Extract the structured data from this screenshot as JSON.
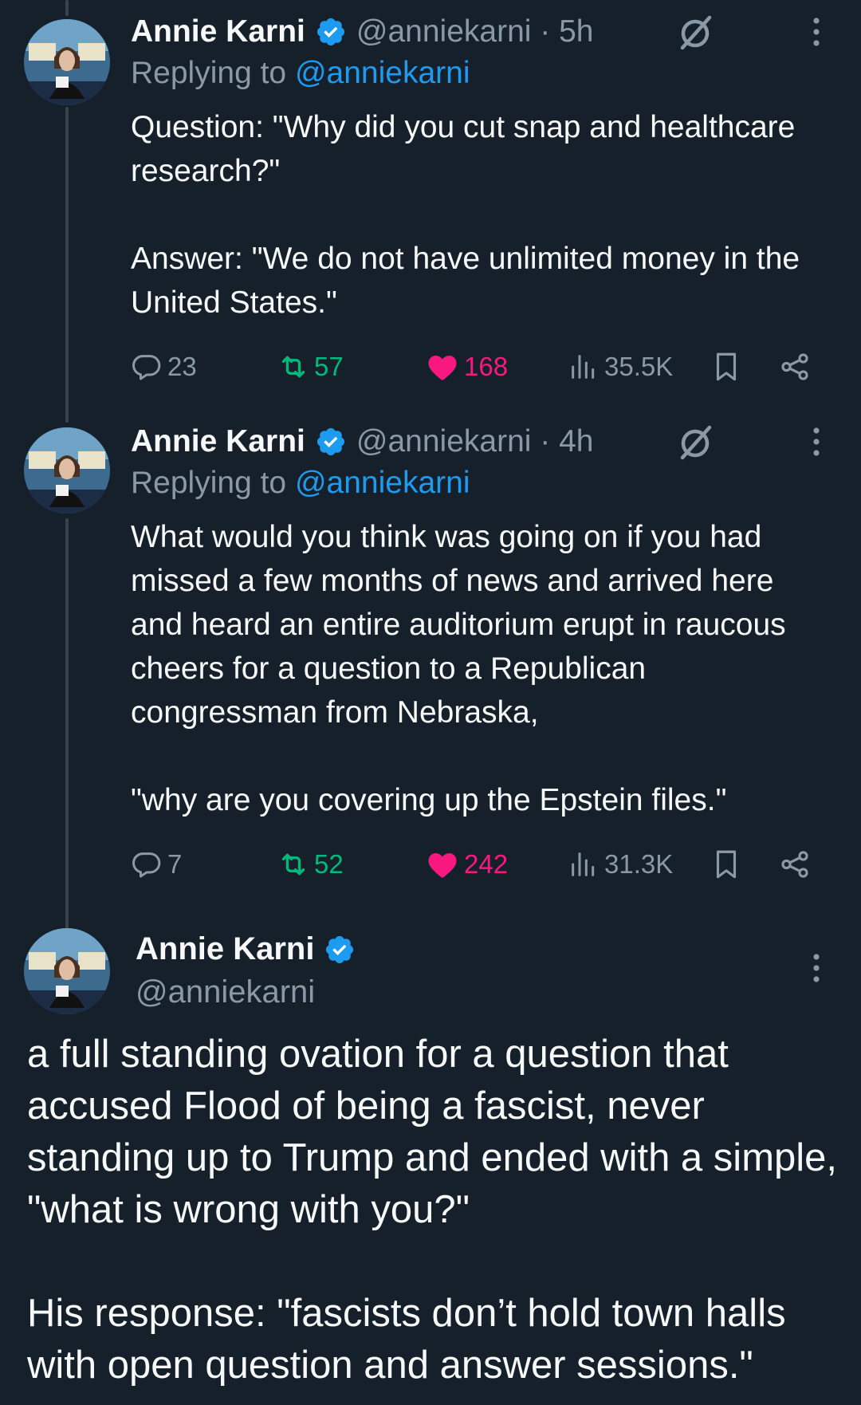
{
  "tweets": [
    {
      "author": "Annie Karni",
      "handle_time": "@anniekarni · 5h",
      "replying_prefix": "Replying to ",
      "replying_handle": "@anniekarni",
      "text": "Question: \"Why did you cut snap and healthcare research?\"\n\nAnswer: \"We do not have unlimited money in the United States.\"",
      "replies": "23",
      "retweets": "57",
      "likes": "168",
      "views": "35.5K"
    },
    {
      "author": "Annie Karni",
      "handle_time": "@anniekarni · 4h",
      "replying_prefix": "Replying to ",
      "replying_handle": "@anniekarni",
      "text": "What would you think was going on if you had missed a few months of news and arrived here and heard an entire auditorium erupt in raucous cheers for a question to a Republican congressman from Nebraska,\n\n\"why are you covering up the Epstein files.\"",
      "replies": "7",
      "retweets": "52",
      "likes": "242",
      "views": "31.3K"
    }
  ],
  "main_tweet": {
    "author": "Annie Karni",
    "handle": "@anniekarni",
    "text": "a full standing ovation for a question that accused Flood of being a fascist, never standing up to Trump and ended with a simple, \"what is wrong with you?\"\n\nHis response: \"fascists don’t hold town halls with open question and answer sessions.\""
  },
  "colors": {
    "background": "#15202b",
    "accent": "#1d9bf0",
    "retweet": "#00ba7c",
    "like": "#f91880",
    "muted": "#8b98a5"
  },
  "icons": [
    "verified-badge-icon",
    "grok-icon",
    "more-options-icon",
    "reply-icon",
    "retweet-icon",
    "like-icon",
    "views-icon",
    "bookmark-icon",
    "share-icon"
  ]
}
